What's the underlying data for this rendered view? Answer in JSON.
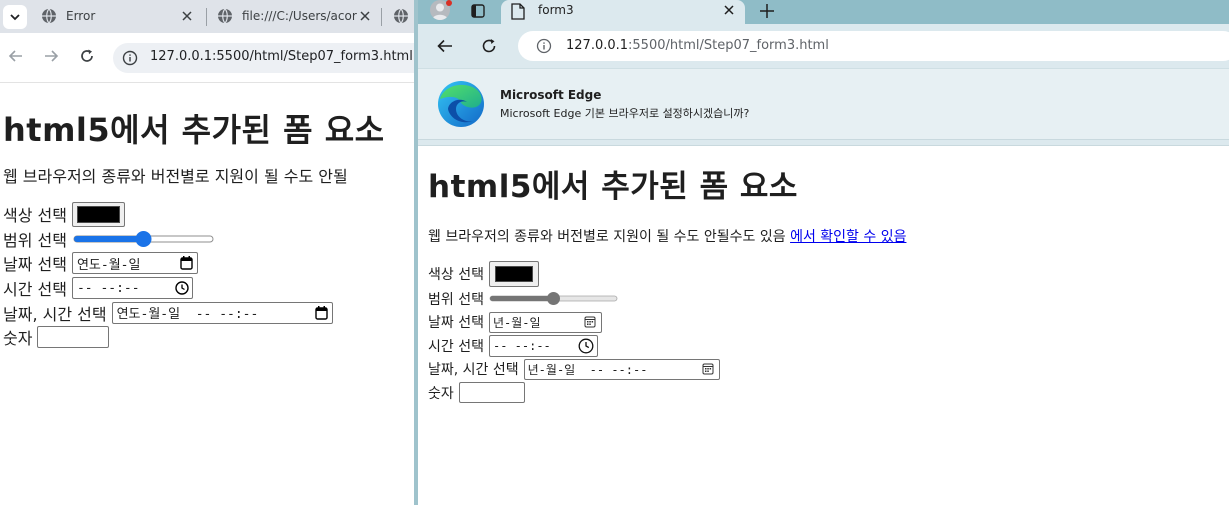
{
  "left_window": {
    "tabs": [
      {
        "title": "Error"
      },
      {
        "title": "file:///C:/Users/acor"
      }
    ],
    "address": "127.0.0.1:5500/html/Step07_form3.html",
    "page": {
      "heading": "html5에서 추가된 폼 요소",
      "description": "웹 브라우저의 종류와 버전별로 지원이 될 수도 안될",
      "form": {
        "color_label": "색상 선택",
        "color_value": "#000000",
        "range_label": "범위 선택",
        "range_value": 50,
        "date_label": "날짜 선택",
        "date_placeholder": "연도-월-일",
        "time_label": "시간 선택",
        "time_placeholder": "-- --:--",
        "datetime_label": "날짜, 시간 선택",
        "datetime_placeholder": "연도-월-일  -- --:--",
        "number_label": "숫자"
      }
    }
  },
  "right_window": {
    "tab": {
      "title": "form3"
    },
    "address_host": "127.0.0.1",
    "address_path": ":5500/html/Step07_form3.html",
    "infobar": {
      "title": "Microsoft Edge",
      "message": "Microsoft Edge 기본 브라우저로 설정하시겠습니까?"
    },
    "page": {
      "heading": "html5에서 추가된 폼 요소",
      "description": "웹 브라우저의 종류와 버전별로 지원이 될 수도 안될수도 있음 ",
      "link": "에서 확인할 수 있음",
      "form": {
        "color_label": "색상 선택",
        "color_value": "#000000",
        "range_label": "범위 선택",
        "range_value": 50,
        "date_label": "날짜 선택",
        "date_placeholder": "년-월-일",
        "time_label": "시간 선택",
        "time_placeholder": "-- --:--",
        "datetime_label": "날짜, 시간 선택",
        "datetime_placeholder": "년-월-일  -- --:--",
        "number_label": "숫자"
      }
    }
  },
  "colors": {
    "chrome_tabstrip": "#dfe3e9",
    "edge_tabstrip": "#8fbcc7",
    "edge_toolbar": "#dce9ee",
    "slider_chrome": "#1a73e8",
    "slider_edge": "#757575",
    "link": "#0000ee"
  },
  "icons": {
    "tab_favicon": "globe-icon",
    "nav_back": "arrow-left-icon",
    "nav_forward": "arrow-right-icon",
    "reload": "reload-icon",
    "site_info": "info-icon",
    "edge_logo": "edge-logo-icon",
    "calendar": "calendar-icon",
    "clock": "clock-icon"
  }
}
